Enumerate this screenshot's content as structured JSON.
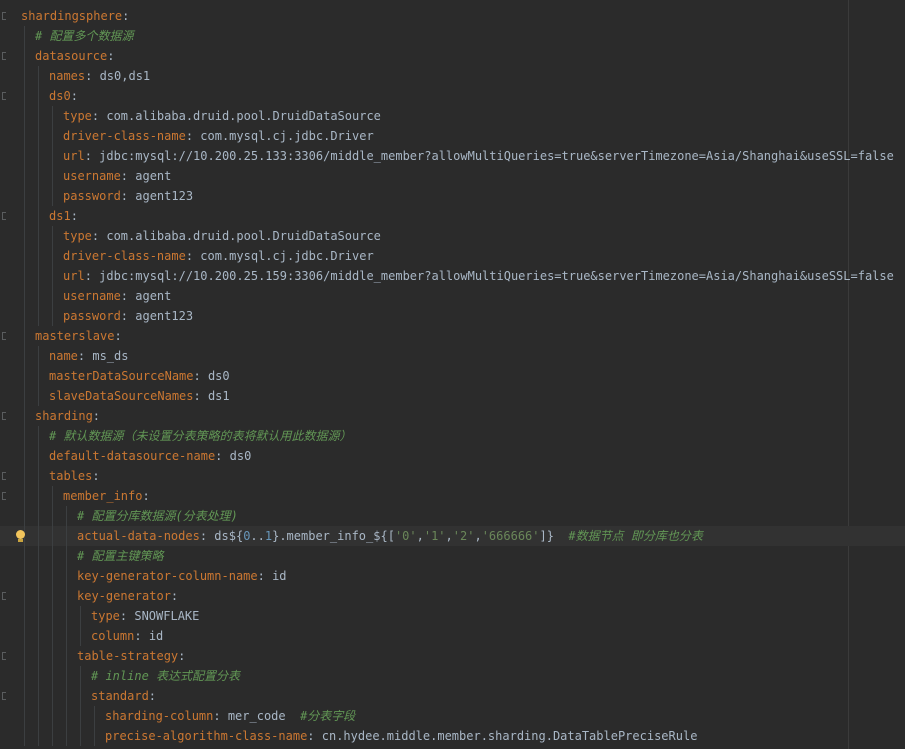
{
  "lines": [
    {
      "k": "shardingsphere",
      "sep": ":",
      "v": ""
    },
    {
      "comment": "# 配置多个数据源"
    },
    {
      "k": "datasource",
      "sep": ":",
      "v": ""
    },
    {
      "k": "names",
      "sep": ": ",
      "v": "ds0,ds1"
    },
    {
      "k": "ds0",
      "sep": ":",
      "v": ""
    },
    {
      "k": "type",
      "sep": ": ",
      "v": "com.alibaba.druid.pool.DruidDataSource"
    },
    {
      "k": "driver-class-name",
      "sep": ": ",
      "v": "com.mysql.cj.jdbc.Driver"
    },
    {
      "k": "url",
      "sep": ": ",
      "v": "jdbc:mysql://10.200.25.133:3306/middle_member?allowMultiQueries=true&serverTimezone=Asia/Shanghai&useSSL=false"
    },
    {
      "k": "username",
      "sep": ": ",
      "v": "agent"
    },
    {
      "k": "password",
      "sep": ": ",
      "v": "agent123"
    },
    {
      "k": "ds1",
      "sep": ":",
      "v": ""
    },
    {
      "k": "type",
      "sep": ": ",
      "v": "com.alibaba.druid.pool.DruidDataSource"
    },
    {
      "k": "driver-class-name",
      "sep": ": ",
      "v": "com.mysql.cj.jdbc.Driver"
    },
    {
      "k": "url",
      "sep": ": ",
      "v": "jdbc:mysql://10.200.25.159:3306/middle_member?allowMultiQueries=true&serverTimezone=Asia/Shanghai&useSSL=false"
    },
    {
      "k": "username",
      "sep": ": ",
      "v": "agent"
    },
    {
      "k": "password",
      "sep": ": ",
      "v": "agent123"
    },
    {
      "k": "masterslave",
      "sep": ":",
      "v": ""
    },
    {
      "k": "name",
      "sep": ": ",
      "v": "ms_ds"
    },
    {
      "k": "masterDataSourceName",
      "sep": ": ",
      "v": "ds0"
    },
    {
      "k": "slaveDataSourceNames",
      "sep": ": ",
      "v": "ds1"
    },
    {
      "k": "sharding",
      "sep": ":",
      "v": ""
    },
    {
      "comment": "# 默认数据源（未设置分表策略的表将默认用此数据源）"
    },
    {
      "k": "default-datasource-name",
      "sep": ": ",
      "v": "ds0"
    },
    {
      "k": "tables",
      "sep": ":",
      "v": ""
    },
    {
      "k": "member_info",
      "sep": ":",
      "v": ""
    },
    {
      "comment": "# 配置分库数据源(分表处理)"
    },
    {
      "k": "actual-data-nodes",
      "sep": ": ",
      "v": "ds${0..1}.member_info_${['0','1','2','666666']}",
      "trail": "  #数据节点 即分库也分表"
    },
    {
      "comment": "# 配置主键策略"
    },
    {
      "k": "key-generator-column-name",
      "sep": ": ",
      "v": "id"
    },
    {
      "k": "key-generator",
      "sep": ":",
      "v": ""
    },
    {
      "k": "type",
      "sep": ": ",
      "v": "SNOWFLAKE"
    },
    {
      "k": "column",
      "sep": ": ",
      "v": "id"
    },
    {
      "k": "table-strategy",
      "sep": ":",
      "v": ""
    },
    {
      "comment": "# inline 表达式配置分表"
    },
    {
      "k": "standard",
      "sep": ":",
      "v": ""
    },
    {
      "k": "sharding-column",
      "sep": ": ",
      "v": "mer_code",
      "trail": "  #分表字段"
    },
    {
      "k": "precise-algorithm-class-name",
      "sep": ": ",
      "v": "cn.hydee.middle.member.sharding.DataTablePreciseRule"
    }
  ],
  "colors": {
    "background": "#2b2b2b",
    "key": "#cc7832",
    "value": "#a9b7c6",
    "comment": "#629755",
    "number": "#6897bb",
    "string": "#6a8759"
  },
  "icons": {
    "intention_bulb": "lightbulb-icon"
  }
}
